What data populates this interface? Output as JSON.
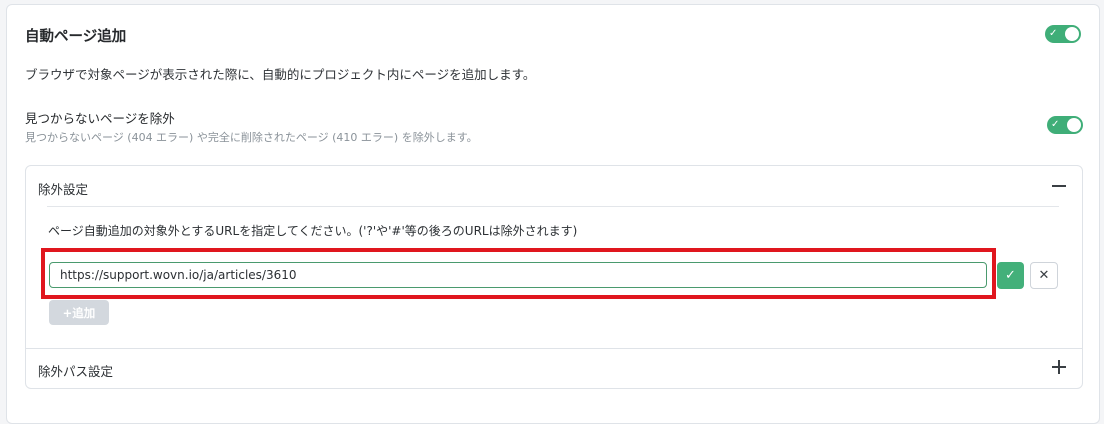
{
  "auto_add": {
    "title": "自動ページ追加",
    "description": "ブラウザで対象ページが表示された際に、自動的にプロジェクト内にページを追加します。",
    "toggle_on": true
  },
  "exclude_not_found": {
    "title": "見つからないページを除外",
    "description": "見つからないページ (404 エラー) や完全に削除されたページ (410 エラー) を除外します。",
    "toggle_on": true
  },
  "exclusion_settings": {
    "header": "除外設定",
    "instruction": "ページ自動追加の対象外とするURLを指定してください。('?'や'#'等の後ろのURLは除外されます)",
    "url_value": "https://support.wovn.io/ja/articles/3610",
    "add_label": "+追加",
    "confirm_icon": "✓",
    "cancel_icon": "✕"
  },
  "exclusion_path_settings": {
    "header": "除外パス設定"
  },
  "colors": {
    "accent": "#3fae78",
    "highlight": "#e0161e"
  }
}
